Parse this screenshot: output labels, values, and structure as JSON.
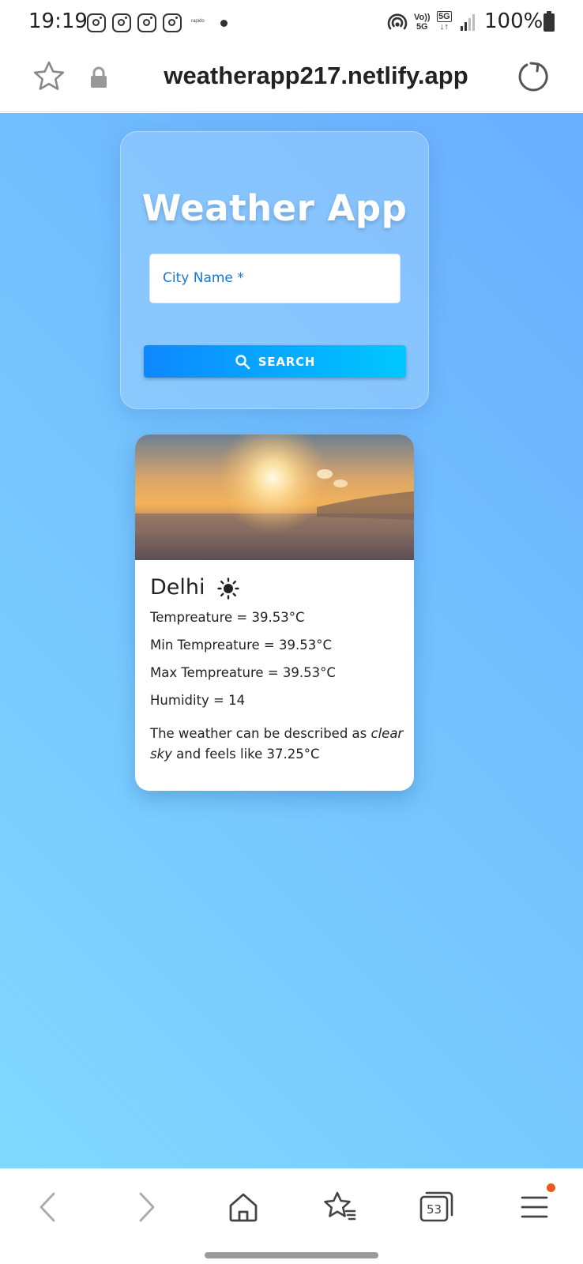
{
  "status_bar": {
    "time": "19:19",
    "notification_icons": [
      "instagram-icon",
      "instagram-icon",
      "instagram-icon",
      "instagram-icon"
    ],
    "tiny_app_label": "rapido",
    "network_volte": "Vo)) 5G",
    "network_5g": "5G",
    "battery": "100%"
  },
  "browser": {
    "url": "weatherapp217.netlify.app",
    "icons": [
      "star-icon",
      "lock-icon",
      "reload-icon"
    ]
  },
  "app": {
    "title": "Weather App",
    "search_placeholder": "City Name *",
    "search_button": "SEARCH",
    "colors": {
      "accent": "#1976d2",
      "button_start": "#0e87ff",
      "button_end": "#00c8ff"
    }
  },
  "weather": {
    "city": "Delhi",
    "icon": "sun-icon",
    "temperature": "Tempreature = 39.53°C",
    "min_temperature": "Min Tempreature = 39.53°C",
    "max_temperature": "Max Tempreature = 39.53°C",
    "humidity": "Humidity = 14",
    "desc_prefix": "The weather can be described as ",
    "desc_condition": "clear sky",
    "desc_suffix": " and feels like 37.25°C"
  },
  "bottom_nav": {
    "tab_count": "53",
    "icons": [
      "back-icon",
      "forward-icon",
      "home-icon",
      "bookmarks-icon",
      "tabs-icon",
      "menu-icon"
    ]
  }
}
